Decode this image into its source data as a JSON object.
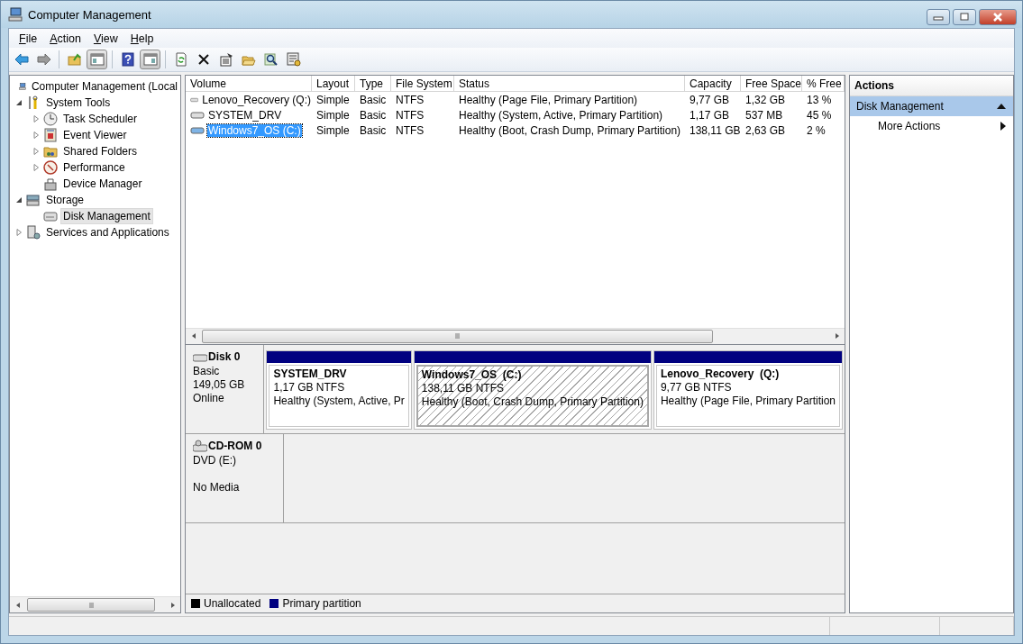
{
  "window": {
    "title": "Computer Management"
  },
  "menu": [
    {
      "label": "File"
    },
    {
      "label": "Action"
    },
    {
      "label": "View"
    },
    {
      "label": "Help"
    }
  ],
  "toolbar": [
    {
      "kind": "back",
      "pressed": false
    },
    {
      "kind": "forward",
      "pressed": false
    },
    {
      "kind": "sep"
    },
    {
      "kind": "up",
      "pressed": false
    },
    {
      "kind": "tree",
      "pressed": true
    },
    {
      "kind": "sep"
    },
    {
      "kind": "help",
      "pressed": false
    },
    {
      "kind": "pane",
      "pressed": true
    },
    {
      "kind": "sep"
    },
    {
      "kind": "refresh",
      "pressed": false
    },
    {
      "kind": "delete",
      "pressed": false
    },
    {
      "kind": "properties",
      "pressed": false
    },
    {
      "kind": "open",
      "pressed": false
    },
    {
      "kind": "find",
      "pressed": false
    },
    {
      "kind": "settings",
      "pressed": false
    }
  ],
  "tree": [
    {
      "label": "Computer Management (Local",
      "kind": "computer",
      "selected": false,
      "children": [
        {
          "label": "System Tools",
          "kind": "tools",
          "expanded": true,
          "selected": false,
          "children": [
            {
              "label": "Task Scheduler",
              "kind": "clock",
              "expanded": false,
              "selected": false
            },
            {
              "label": "Event Viewer",
              "kind": "log",
              "expanded": false,
              "selected": false
            },
            {
              "label": "Shared Folders",
              "kind": "folder",
              "expanded": false,
              "selected": false
            },
            {
              "label": "Performance",
              "kind": "gauge",
              "expanded": false,
              "selected": false
            },
            {
              "label": "Device Manager",
              "kind": "device",
              "selected": false
            }
          ]
        },
        {
          "label": "Storage",
          "kind": "storage",
          "expanded": true,
          "selected": false,
          "children": [
            {
              "label": "Disk Management",
              "kind": "disk",
              "selected": true
            }
          ]
        },
        {
          "label": "Services and Applications",
          "kind": "services",
          "expanded": false,
          "selected": false
        }
      ]
    }
  ],
  "volumes": {
    "columns": [
      "Volume",
      "Layout",
      "Type",
      "File System",
      "Status",
      "Capacity",
      "Free Space",
      "% Free"
    ],
    "rows": [
      {
        "cells": [
          "Lenovo_Recovery (Q:)",
          "Simple",
          "Basic",
          "NTFS",
          "Healthy (Page File, Primary Partition)",
          "9,77 GB",
          "1,32 GB",
          "13 %"
        ],
        "selected": false
      },
      {
        "cells": [
          "SYSTEM_DRV",
          "Simple",
          "Basic",
          "NTFS",
          "Healthy (System, Active, Primary Partition)",
          "1,17 GB",
          "537 MB",
          "45 %"
        ],
        "selected": false
      },
      {
        "cells": [
          "Windows7_OS (C:)",
          "Simple",
          "Basic",
          "NTFS",
          "Healthy (Boot, Crash Dump, Primary Partition)",
          "138,11 GB",
          "2,63 GB",
          "2 %"
        ],
        "selected": true
      }
    ]
  },
  "disks": [
    {
      "kind": "disk",
      "name": "Disk 0",
      "lines": [
        "Basic",
        "149,05 GB",
        "Online"
      ],
      "partitions": [
        {
          "name": "SYSTEM_DRV",
          "size": "1,17 GB NTFS",
          "status": "Healthy (System, Active, Pr",
          "selected": false,
          "color": "#000080"
        },
        {
          "name": "Windows7_OS  (C:)",
          "size": "138,11 GB NTFS",
          "status": "Healthy (Boot, Crash Dump, Primary Partition)",
          "selected": true,
          "color": "#000080"
        },
        {
          "name": "Lenovo_Recovery  (Q:)",
          "size": "9,77 GB NTFS",
          "status": "Healthy (Page File, Primary Partition",
          "selected": false,
          "color": "#000080"
        }
      ]
    },
    {
      "kind": "cdrom",
      "name": "CD-ROM 0",
      "lines": [
        "DVD (E:)",
        "No Media"
      ]
    }
  ],
  "legend": [
    {
      "label": "Unallocated",
      "color": "#000000"
    },
    {
      "label": "Primary partition",
      "color": "#000080"
    }
  ],
  "actions": {
    "title": "Actions",
    "section": {
      "label": "Disk Management",
      "expanded": true
    },
    "items": [
      {
        "label": "More Actions"
      }
    ]
  }
}
